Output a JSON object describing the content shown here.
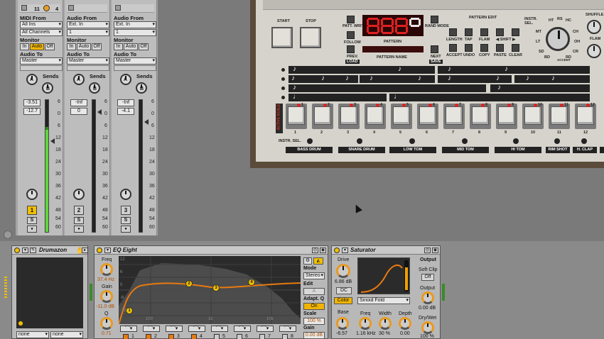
{
  "tracks": [
    {
      "header": {
        "left": "11",
        "right": "4"
      },
      "routing": {
        "in_label": "MIDI From",
        "in_value": "All Ins",
        "in_channel": "All Channels",
        "monitor_label": "Monitor",
        "monitor_in": "In",
        "monitor_auto": "Auto",
        "monitor_off": "Off",
        "out_label": "Audio To",
        "out_value": "Master"
      },
      "sends_label": "Sends",
      "send_a": "A",
      "send_b": "B",
      "vol_value": "-3.51",
      "vol_value2": "-12.7",
      "number": "1",
      "solo": "S",
      "rec": "●",
      "scale": [
        "6",
        "0",
        "6",
        "12",
        "18",
        "24",
        "30",
        "36",
        "42",
        "48",
        "54",
        "60"
      ]
    },
    {
      "routing": {
        "in_label": "Audio From",
        "in_value": "Ext. In",
        "in_channel": "1",
        "monitor_label": "Monitor",
        "monitor_in": "In",
        "monitor_auto": "Auto",
        "monitor_off": "Off",
        "out_label": "Audio To",
        "out_value": "Master"
      },
      "sends_label": "Sends",
      "send_a": "A",
      "send_b": "B",
      "vol_value": "-Inf",
      "vol_value2": "0",
      "number": "2",
      "solo": "S",
      "rec": "●",
      "scale": [
        "6",
        "0",
        "6",
        "12",
        "18",
        "24",
        "30",
        "36",
        "42",
        "48",
        "54",
        "60"
      ]
    },
    {
      "routing": {
        "in_label": "Audio From",
        "in_value": "Ext. In",
        "in_channel": "1",
        "monitor_label": "Monitor",
        "monitor_in": "In",
        "monitor_auto": "Auto",
        "monitor_off": "Off",
        "out_label": "Audio To",
        "out_value": "Master"
      },
      "sends_label": "Sends",
      "send_a": "A",
      "send_b": "B",
      "vol_value": "-Inf",
      "vol_value2": "-4.1",
      "number": "3",
      "solo": "S",
      "rec": "●",
      "scale": [
        "6",
        "0",
        "6",
        "12",
        "18",
        "24",
        "30",
        "36",
        "42",
        "48",
        "54",
        "60"
      ]
    }
  ],
  "drum": {
    "start": "START",
    "stop": "STOP",
    "patt_write": "PATT. WRITE",
    "follow": "FOLLOW",
    "prev": "PREV.",
    "load": "LOAD",
    "pattern": "PATTERN",
    "pattern_name": "PATTERN NAME",
    "rand_mode": "RAND MODE",
    "next": "NEXT",
    "save": "SAVE",
    "pattern_edit": "PATTERN EDIT",
    "edit_row1": [
      "LENGTH",
      "TAP",
      "FLAM",
      "◀ SHIFT ▶"
    ],
    "edit_row2": [
      "ACCEPT",
      "UNDO",
      "COPY",
      "PASTE",
      "CLEAR"
    ],
    "instr_sel": "INSTR. SEL.",
    "dial_labels": [
      "HT",
      "RS",
      "HC",
      "MT",
      "CH",
      "LT",
      "OH",
      "SD",
      "CR",
      "BD",
      "RD",
      "ACCENT"
    ],
    "shuffle": "SHUFFLE",
    "flam": "FLAM",
    "active_scale": "ACTIVE SCALE",
    "step_numbers": [
      "1",
      "2",
      "3",
      "4",
      "5",
      "6",
      "7",
      "8",
      "9",
      "10",
      "11",
      "12"
    ],
    "step_sub": [
      "1",
      "2",
      "3",
      "4",
      "5",
      "6",
      "7",
      "8",
      "9",
      "10",
      "11",
      "12"
    ],
    "instruments": [
      "BASS DRUM",
      "SNARE DRUM",
      "LOW TOM",
      "MID TOM",
      "HI TOM",
      "RIM SHOT",
      "H. CLAP",
      "CL"
    ]
  },
  "drumazon": {
    "title": "Drumazon",
    "sel1": "none",
    "sel2": "none"
  },
  "eq": {
    "title": "EQ Eight",
    "freq_label": "Freq",
    "freq_value": "37.4 Hz",
    "gain_label": "Gain",
    "gain_value": "-11.0 dB",
    "q_label": "Q",
    "q_value": "0.71",
    "grid_db": [
      "12",
      "6",
      "0",
      "-6",
      "-12"
    ],
    "grid_hz": [
      "100",
      "1k",
      "10k"
    ],
    "points": [
      "1",
      "2",
      "3",
      "4"
    ],
    "mode_label": "Mode",
    "mode_value": "Stereo",
    "edit_label": "Edit",
    "edit_value": "A",
    "adaptq_label": "Adapt. Q",
    "adaptq_value": "On",
    "scale_label": "Scale",
    "scale_value": "100 %",
    "gain2_label": "Gain",
    "gain2_value": "0.00 dB",
    "bands": [
      "1",
      "2",
      "3",
      "4",
      "5",
      "6",
      "7",
      "8"
    ]
  },
  "saturator": {
    "title": "Saturator",
    "drive_label": "Drive",
    "drive_value": "6.86 dB",
    "dc": "DC",
    "color": "Color",
    "curve": "Sinoid Fold",
    "output_head": "Output",
    "softclip_label": "Soft Clip",
    "softclip_value": "Off",
    "output_label": "Output",
    "output_value": "0.00 dB",
    "base_label": "Base",
    "base_value": "-6.57",
    "freq_label": "Freq",
    "freq_value": "1.16 kHz",
    "width_label": "Width",
    "width_value": "30 %",
    "depth_label": "Depth",
    "depth_value": "0.00",
    "drywet_label": "Dry/Wet",
    "drywet_value": "100 %"
  },
  "colors": {
    "accent": "#f0c000",
    "orange_curve": "#e87a10",
    "led_red": "#e02020"
  }
}
